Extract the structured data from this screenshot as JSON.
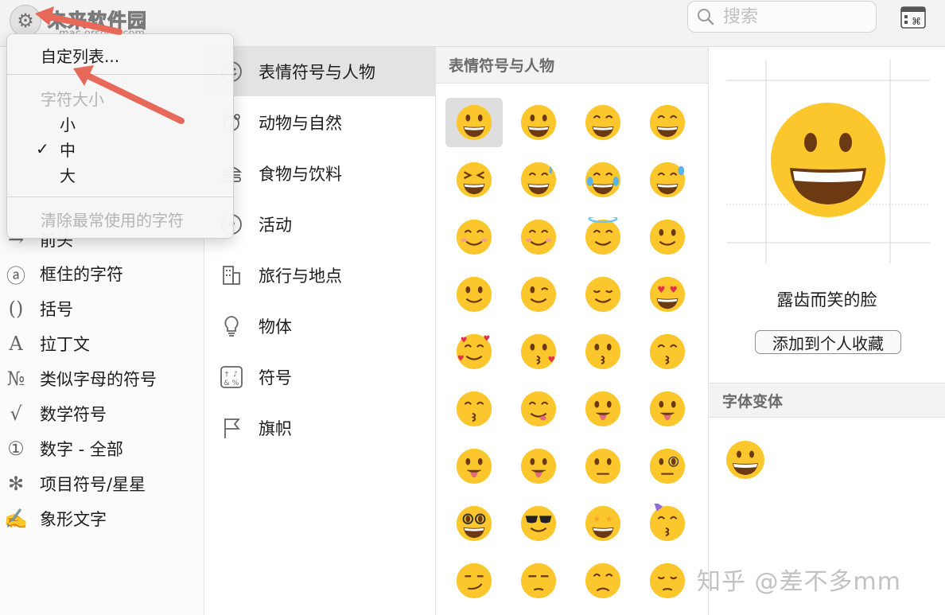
{
  "toolbar": {
    "watermark_title": "未来软件园",
    "watermark_url": "mac.orsoon.com",
    "search_placeholder": "搜索",
    "gear_icon": "gear-icon",
    "keyboard_icon": "keyboard-viewer-icon"
  },
  "menu": {
    "customize_label": "自定列表...",
    "font_size_header": "字符大小",
    "sizes": [
      "小",
      "中",
      "大"
    ],
    "checked_size": "中",
    "clear_label": "清除最常使用的字符"
  },
  "left_list": [
    {
      "label": "前头",
      "icon": "→"
    },
    {
      "label": "框住的字符",
      "icon": "ⓐ"
    },
    {
      "label": "括号",
      "icon": "()"
    },
    {
      "label": "拉丁文",
      "icon": "A"
    },
    {
      "label": "类似字母的符号",
      "icon": "№"
    },
    {
      "label": "数学符号",
      "icon": "√"
    },
    {
      "label": "数字 - 全部",
      "icon": "①"
    },
    {
      "label": "项目符号/星星",
      "icon": "✻"
    },
    {
      "label": "象形文字",
      "icon": "✍"
    }
  ],
  "categories": [
    {
      "label": "表情符号与人物",
      "icon": "smiley-icon",
      "selected": true
    },
    {
      "label": "动物与自然",
      "icon": "bear-icon"
    },
    {
      "label": "食物与饮料",
      "icon": "burger-icon"
    },
    {
      "label": "活动",
      "icon": "soccer-ball-icon"
    },
    {
      "label": "旅行与地点",
      "icon": "building-icon"
    },
    {
      "label": "物体",
      "icon": "lightbulb-icon"
    },
    {
      "label": "符号",
      "icon": "symbols-icon"
    },
    {
      "label": "旗帜",
      "icon": "flag-icon"
    }
  ],
  "grid": {
    "header": "表情符号与人物",
    "emojis": [
      "grinning",
      "smiley",
      "smile",
      "grin",
      "laughing",
      "sweat-smile",
      "joy",
      "rofl",
      "relaxed",
      "blush",
      "innocent",
      "slight-smile",
      "upside-down",
      "wink",
      "relieved",
      "heart-eyes",
      "smiling-hearts",
      "kissing-heart",
      "kissing",
      "kissing-smiling-eyes",
      "kissing-closed-eyes",
      "yum",
      "tongue",
      "squinting-tongue",
      "winking-tongue",
      "zany",
      "raised-eyebrow",
      "monocle",
      "nerd",
      "sunglasses",
      "star-struck",
      "partying",
      "smirk",
      "unamused",
      "disappointed",
      "pensive"
    ]
  },
  "detail": {
    "name": "露齿而笑的脸",
    "add_favorite": "添加到个人收藏",
    "variants_header": "字体变体"
  },
  "watermark": "知乎 @差不多mm",
  "colors": {
    "arrow": "#e8685a",
    "emoji_yellow": "#fcc72d",
    "emoji_dark": "#6b3a12",
    "selected_bg": "#e3e3e3"
  }
}
